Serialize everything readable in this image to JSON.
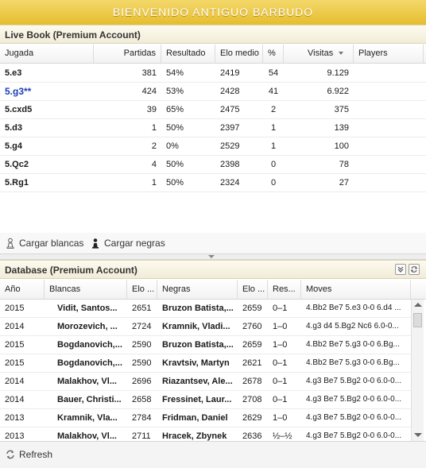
{
  "banner": {
    "title": "BIENVENIDO ANTIGUO BARBUDO"
  },
  "live_book": {
    "title": "Live Book (Premium Account)",
    "columns": [
      "Jugada",
      "Partidas",
      "Resultado",
      "Elo medio",
      "%",
      "Visitas",
      "Players"
    ],
    "sort_icon": "sort-down-icon",
    "rows": [
      {
        "move": "5.e3",
        "games": "381",
        "result": "54%",
        "elo": "2419",
        "pct": "54",
        "visits": "9.129"
      },
      {
        "move": "5.g3**",
        "games": "424",
        "result": "53%",
        "elo": "2428",
        "pct": "41",
        "visits": "6.922"
      },
      {
        "move": "5.cxd5",
        "games": "39",
        "result": "65%",
        "elo": "2475",
        "pct": "2",
        "visits": "375"
      },
      {
        "move": "5.d3",
        "games": "1",
        "result": "50%",
        "elo": "2397",
        "pct": "1",
        "visits": "139"
      },
      {
        "move": "5.g4",
        "games": "2",
        "result": "0%",
        "elo": "2529",
        "pct": "1",
        "visits": "100"
      },
      {
        "move": "5.Qc2",
        "games": "4",
        "result": "50%",
        "elo": "2398",
        "pct": "0",
        "visits": "78"
      },
      {
        "move": "5.Rg1",
        "games": "1",
        "result": "50%",
        "elo": "2324",
        "pct": "0",
        "visits": "27"
      }
    ],
    "load_white": "Cargar blancas",
    "load_black": "Cargar negras"
  },
  "database": {
    "title": "Database (Premium Account)",
    "columns": [
      "Año",
      "Blancas",
      "Elo ...",
      "Negras",
      "Elo ...",
      "Res...",
      "Moves"
    ],
    "rows": [
      {
        "year": "2015",
        "white": "Vidit, Santos...",
        "elo_w": "2651",
        "black": "Bruzon Batista,...",
        "elo_b": "2659",
        "res": "0–1",
        "moves": "4.Bb2 Be7 5.e3 0-0 6.d4 ..."
      },
      {
        "year": "2014",
        "white": "Morozevich, ...",
        "elo_w": "2724",
        "black": "Kramnik, Vladi...",
        "elo_b": "2760",
        "res": "1–0",
        "moves": "4.g3 d4 5.Bg2 Nc6 6.0-0..."
      },
      {
        "year": "2015",
        "white": "Bogdanovich,...",
        "elo_w": "2590",
        "black": "Bruzon Batista,...",
        "elo_b": "2659",
        "res": "1–0",
        "moves": "4.Bb2 Be7 5.g3 0-0 6.Bg..."
      },
      {
        "year": "2015",
        "white": "Bogdanovich,...",
        "elo_w": "2590",
        "black": "Kravtsiv, Martyn",
        "elo_b": "2621",
        "res": "0–1",
        "moves": "4.Bb2 Be7 5.g3 0-0 6.Bg..."
      },
      {
        "year": "2014",
        "white": "Malakhov, Vl...",
        "elo_w": "2696",
        "black": "Riazantsev, Ale...",
        "elo_b": "2678",
        "res": "0–1",
        "moves": "4.g3 Be7 5.Bg2 0-0 6.0-0..."
      },
      {
        "year": "2014",
        "white": "Bauer, Christi...",
        "elo_w": "2658",
        "black": "Fressinet, Laur...",
        "elo_b": "2708",
        "res": "0–1",
        "moves": "4.g3 Be7 5.Bg2 0-0 6.0-0..."
      },
      {
        "year": "2013",
        "white": "Kramnik, Vla...",
        "elo_w": "2784",
        "black": "Fridman, Daniel",
        "elo_b": "2629",
        "res": "1–0",
        "moves": "4.g3 Be7 5.Bg2 0-0 6.0-0..."
      },
      {
        "year": "2013",
        "white": "Malakhov, Vl...",
        "elo_w": "2711",
        "black": "Hracek, Zbynek",
        "elo_b": "2636",
        "res": "½–½",
        "moves": "4.g3 Be7 5.Bg2 0-0 6.0-0..."
      }
    ],
    "refresh": "Refresh"
  },
  "colors": {
    "banner": "#e6bd2e",
    "selected_move": "#1f3fb8"
  }
}
